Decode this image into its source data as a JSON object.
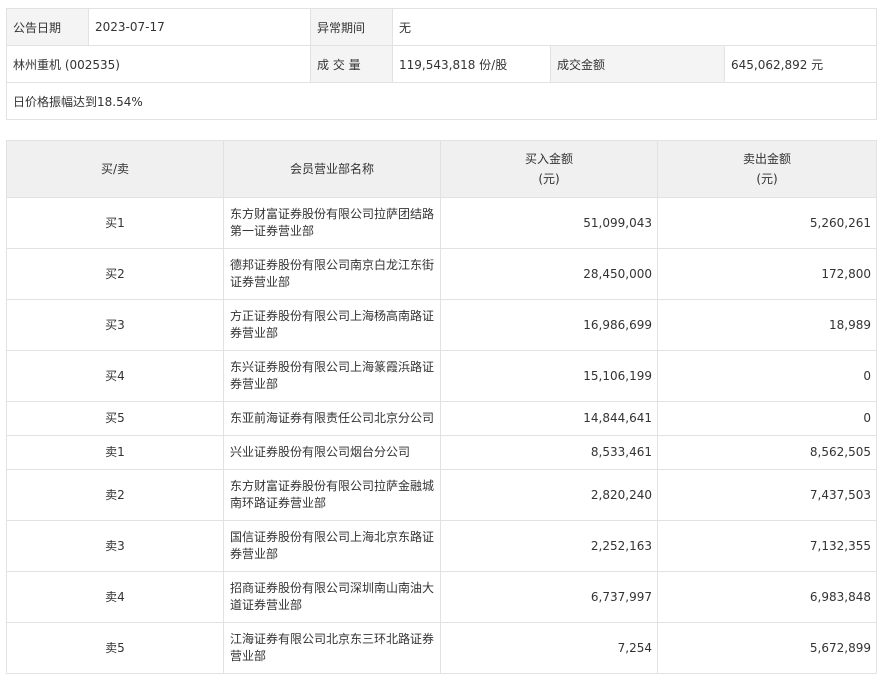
{
  "info": {
    "date_label": "公告日期",
    "date_value": "2023-07-17",
    "period_label": "异常期间",
    "period_value": "无",
    "stock_name": "林州重机 (002535)",
    "volume_label": "成 交 量",
    "volume_value": "119,543,818 份/股",
    "amount_label": "成交金额",
    "amount_value": "645,062,892 元",
    "reason": "日价格振幅达到18.54%"
  },
  "table": {
    "headers": {
      "side": "买/卖",
      "name": "会员营业部名称",
      "buy_line1": "买入金额",
      "buy_line2": "(元)",
      "sell_line1": "卖出金额",
      "sell_line2": "(元)"
    },
    "rows": [
      {
        "side": "买1",
        "name": "东方财富证券股份有限公司拉萨团结路第一证券营业部",
        "buy": "51,099,043",
        "sell": "5,260,261"
      },
      {
        "side": "买2",
        "name": "德邦证券股份有限公司南京白龙江东街证券营业部",
        "buy": "28,450,000",
        "sell": "172,800"
      },
      {
        "side": "买3",
        "name": "方正证券股份有限公司上海杨高南路证券营业部",
        "buy": "16,986,699",
        "sell": "18,989"
      },
      {
        "side": "买4",
        "name": "东兴证券股份有限公司上海篆霞浜路证券营业部",
        "buy": "15,106,199",
        "sell": "0"
      },
      {
        "side": "买5",
        "name": "东亚前海证券有限责任公司北京分公司",
        "buy": "14,844,641",
        "sell": "0"
      },
      {
        "side": "卖1",
        "name": "兴业证券股份有限公司烟台分公司",
        "buy": "8,533,461",
        "sell": "8,562,505"
      },
      {
        "side": "卖2",
        "name": "东方财富证券股份有限公司拉萨金融城南环路证券营业部",
        "buy": "2,820,240",
        "sell": "7,437,503"
      },
      {
        "side": "卖3",
        "name": "国信证券股份有限公司上海北京东路证券营业部",
        "buy": "2,252,163",
        "sell": "7,132,355"
      },
      {
        "side": "卖4",
        "name": "招商证券股份有限公司深圳南山南油大道证券营业部",
        "buy": "6,737,997",
        "sell": "6,983,848"
      },
      {
        "side": "卖5",
        "name": "江海证券有限公司北京东三环北路证券营业部",
        "buy": "7,254",
        "sell": "5,672,899"
      }
    ]
  }
}
